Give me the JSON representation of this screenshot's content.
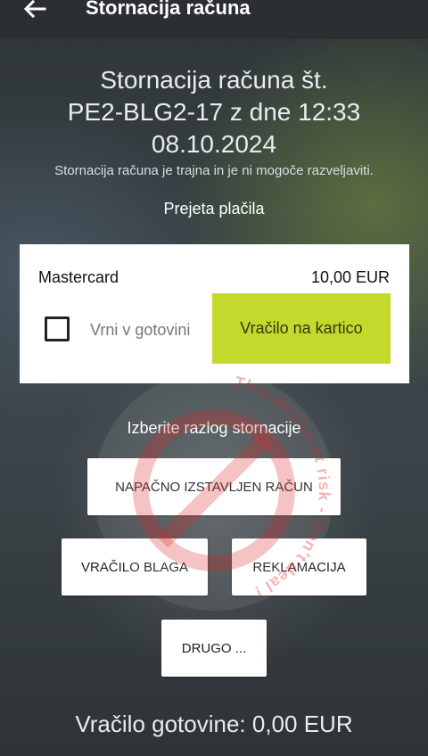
{
  "topbar": {
    "title": "Stornacija računa",
    "back_icon": "arrow-left-icon"
  },
  "heading": {
    "line1": "Stornacija računa št.",
    "line2": "PE2-BLG2-17 z dne 12:33",
    "line3": "08.10.2024"
  },
  "subtitle": "Stornacija računa je trajna in je ni mogoče razveljaviti.",
  "received_payments_title": "Prejeta plačila",
  "payment": {
    "method": "Mastercard",
    "amount": "10,00 EUR",
    "cash_checkbox_label": "Vrni v gotovini",
    "card_refund_button": "Vračilo na kartico",
    "accent_color": "#c3d92b"
  },
  "reasons": {
    "title": "Izberite razlog stornacije",
    "options": [
      "NAPAČNO IZSTAVLJEN RAČUN",
      "VRAČILO BLAGA",
      "REKLAMACIJA",
      "DRUGO ..."
    ]
  },
  "cash_return": "Vračilo gotovine: 0,00 EUR",
  "watermark": {
    "text": "This device at risk - Don't deal !"
  }
}
